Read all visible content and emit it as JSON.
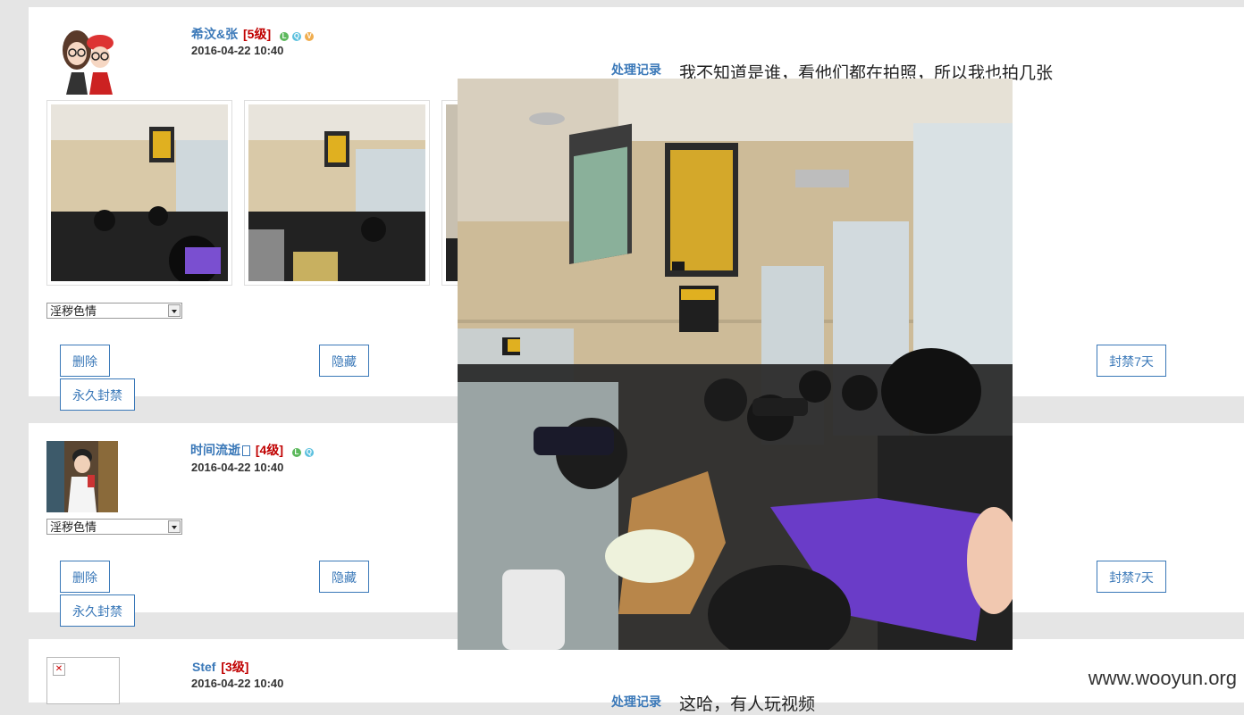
{
  "posts": [
    {
      "username": "希汶&张",
      "level": "[5级]",
      "timestamp": "2016-04-22 10:40",
      "log_label": "处理记录",
      "comment": "我不知道是谁，看他们都在拍照，所以我也拍几张",
      "select_value": "淫秽色情",
      "delete_label": "删除",
      "hide_label": "隐藏",
      "ban7_label": "封禁7天",
      "perma_ban_label": "永久封禁",
      "badge_icons": [
        "level-badge-icon",
        "member-badge-icon",
        "vip-badge-icon"
      ]
    },
    {
      "username": "时间流逝",
      "level": "[4级]",
      "timestamp": "2016-04-22 10:40",
      "select_value": "淫秽色情",
      "delete_label": "删除",
      "hide_label": "隐藏",
      "ban7_label": "封禁7天",
      "perma_ban_label": "永久封禁",
      "badge_icons": [
        "level-badge-icon",
        "member-badge-icon"
      ]
    },
    {
      "username": "Stef",
      "level": "[3级]",
      "timestamp": "2016-04-22 10:40",
      "log_label": "处理记录",
      "comment": "这哈，有人玩视频"
    }
  ],
  "watermark": "www.wooyun.org",
  "colors": {
    "link": "#3a78b8",
    "level": "#c00000",
    "page_bg": "#e5e5e5"
  }
}
